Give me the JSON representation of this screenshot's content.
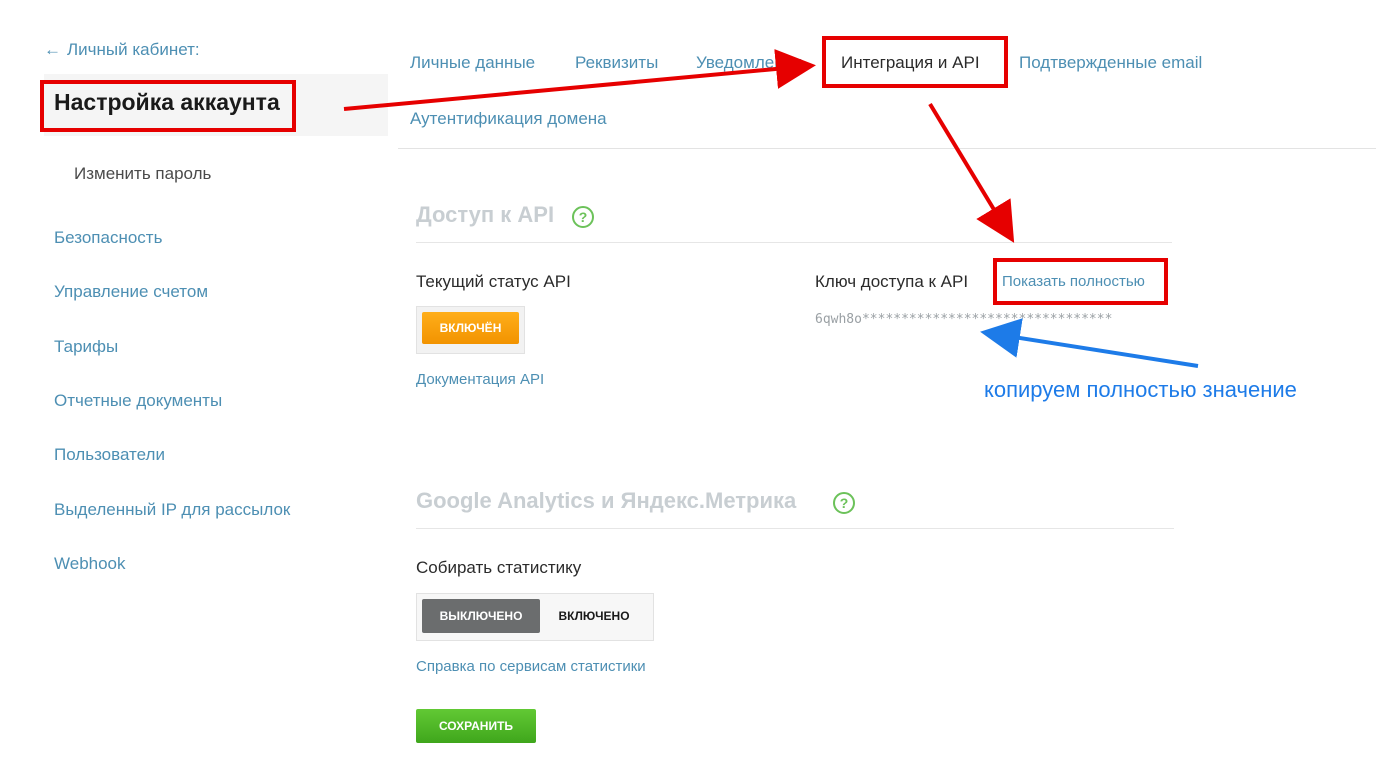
{
  "sidebar": {
    "back_arrow": "←",
    "back_label": "Личный кабинет:",
    "active_title": "Настройка аккаунта",
    "sub_item": "Изменить пароль",
    "items": [
      "Безопасность",
      "Управление счетом",
      "Тарифы",
      "Отчетные документы",
      "Пользователи",
      "Выделенный IP для рассылок",
      "Webhook"
    ]
  },
  "tabs": [
    "Личные данные",
    "Реквизиты",
    "Уведомления",
    "Интеграция и API",
    "Подтвержденные email",
    "Аутентификация домена"
  ],
  "api_section": {
    "title": "Доступ к API",
    "help": "?",
    "status_label": "Текущий статус API",
    "status_button": "ВКЛЮЧЁН",
    "doc_link": "Документация API",
    "key_label": "Ключ доступа к API",
    "show_full_link": "Показать полностью",
    "key_value": "6qwh8o********************************"
  },
  "analytics_section": {
    "title": "Google Analytics и Яндекс.Метрика",
    "help": "?",
    "collect_label": "Собирать статистику",
    "toggle_off": "ВЫКЛЮЧЕНО",
    "toggle_on": "ВКЛЮЧЕНО",
    "help_link": "Справка по сервисам статистики",
    "save_button": "СОХРАНИТЬ"
  },
  "annotation": {
    "text": "копируем полностью значение"
  },
  "colors": {
    "link": "#4d8fb3",
    "highlight": "#e60000",
    "annotation": "#1d7be8",
    "orange": "#f29300",
    "green": "#3fa61c",
    "help_green": "#6cc25a"
  }
}
